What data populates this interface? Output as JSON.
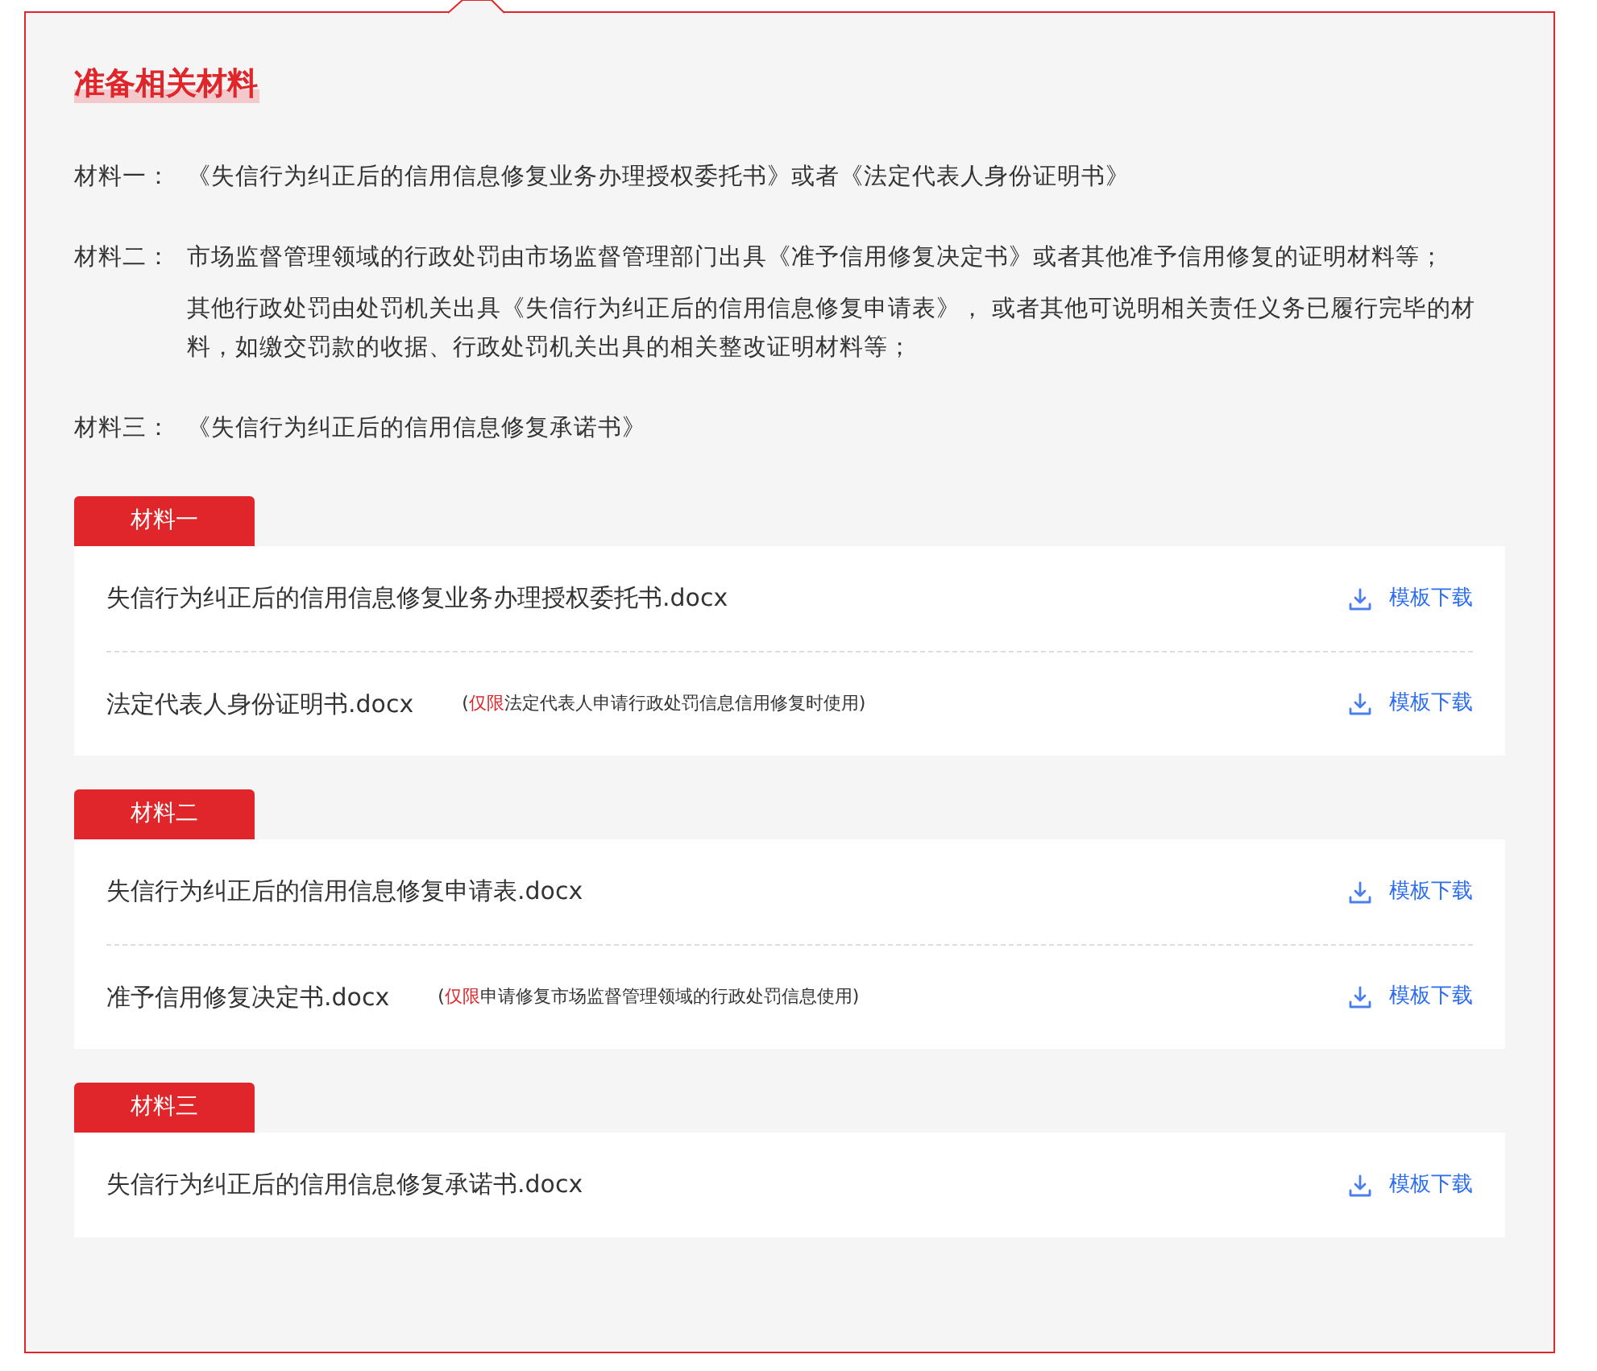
{
  "title": "准备相关材料",
  "materials": [
    {
      "label": "材料一：",
      "paragraphs": [
        "《失信行为纠正后的信用信息修复业务办理授权委托书》或者《法定代表人身份证明书》"
      ]
    },
    {
      "label": "材料二：",
      "paragraphs": [
        "市场监督管理领域的行政处罚由市场监督管理部门出具《准予信用修复决定书》或者其他准予信用修复的证明材料等；",
        "其他行政处罚由处罚机关出具《失信行为纠正后的信用信息修复申请表》， 或者其他可说明相关责任义务已履行完毕的材料，如缴交罚款的收据、行政处罚机关出具的相关整改证明材料等；"
      ]
    },
    {
      "label": "材料三：",
      "paragraphs": [
        "《失信行为纠正后的信用信息修复承诺书》"
      ]
    }
  ],
  "groups": [
    {
      "tab": "材料一",
      "files": [
        {
          "name": "失信行为纠正后的信用信息修复业务办理授权委托书.docx",
          "download": "模板下载"
        },
        {
          "name": "法定代表人身份证明书.docx",
          "note": [
            {
              "text": "(",
              "emphasis": false
            },
            {
              "text": "仅限",
              "emphasis": true
            },
            {
              "text": "法定代表人申请行政处罚信息信用修复时使用)",
              "emphasis": false
            }
          ],
          "download": "模板下载"
        }
      ]
    },
    {
      "tab": "材料二",
      "files": [
        {
          "name": "失信行为纠正后的信用信息修复申请表.docx",
          "download": "模板下载"
        },
        {
          "name": "准予信用修复决定书.docx",
          "note": [
            {
              "text": "(",
              "emphasis": false
            },
            {
              "text": "仅限",
              "emphasis": true
            },
            {
              "text": "申请修复市场监督管理领域的行政处罚信息使用)",
              "emphasis": false
            }
          ],
          "download": "模板下载"
        }
      ]
    },
    {
      "tab": "材料三",
      "files": [
        {
          "name": "失信行为纠正后的信用信息修复承诺书.docx",
          "download": "模板下载"
        }
      ]
    }
  ]
}
